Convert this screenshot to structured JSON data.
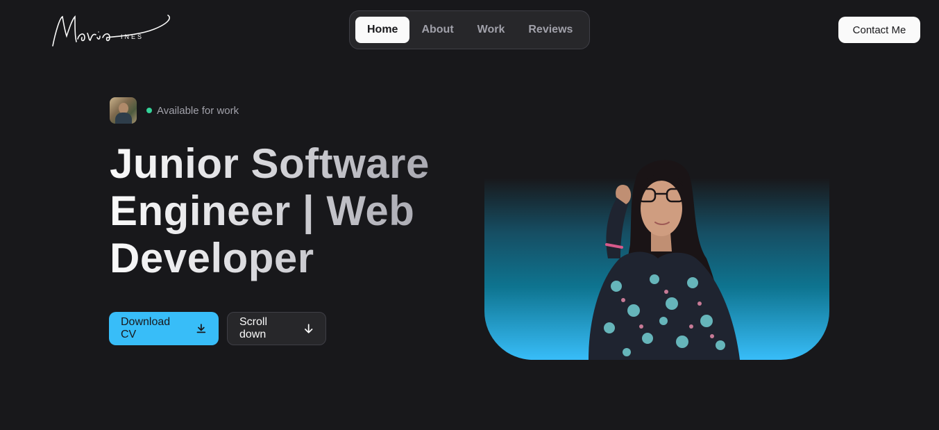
{
  "logo": {
    "script_text": "Maria",
    "sub_text": "INES"
  },
  "nav": {
    "items": [
      {
        "label": "Home",
        "active": true
      },
      {
        "label": "About",
        "active": false
      },
      {
        "label": "Work",
        "active": false
      },
      {
        "label": "Reviews",
        "active": false
      }
    ]
  },
  "contact": {
    "label": "Contact Me"
  },
  "availability": {
    "status": "Available for work",
    "status_color": "#34d399"
  },
  "hero": {
    "headline": "Junior Software Engineer | Web Developer",
    "download_label": "Download CV",
    "scroll_label": "Scroll down"
  },
  "colors": {
    "background": "#18181b",
    "accent": "#38bdf8",
    "surface": "#27272a"
  },
  "icons": {
    "download": "download-icon",
    "scroll": "arrow-down-icon"
  }
}
